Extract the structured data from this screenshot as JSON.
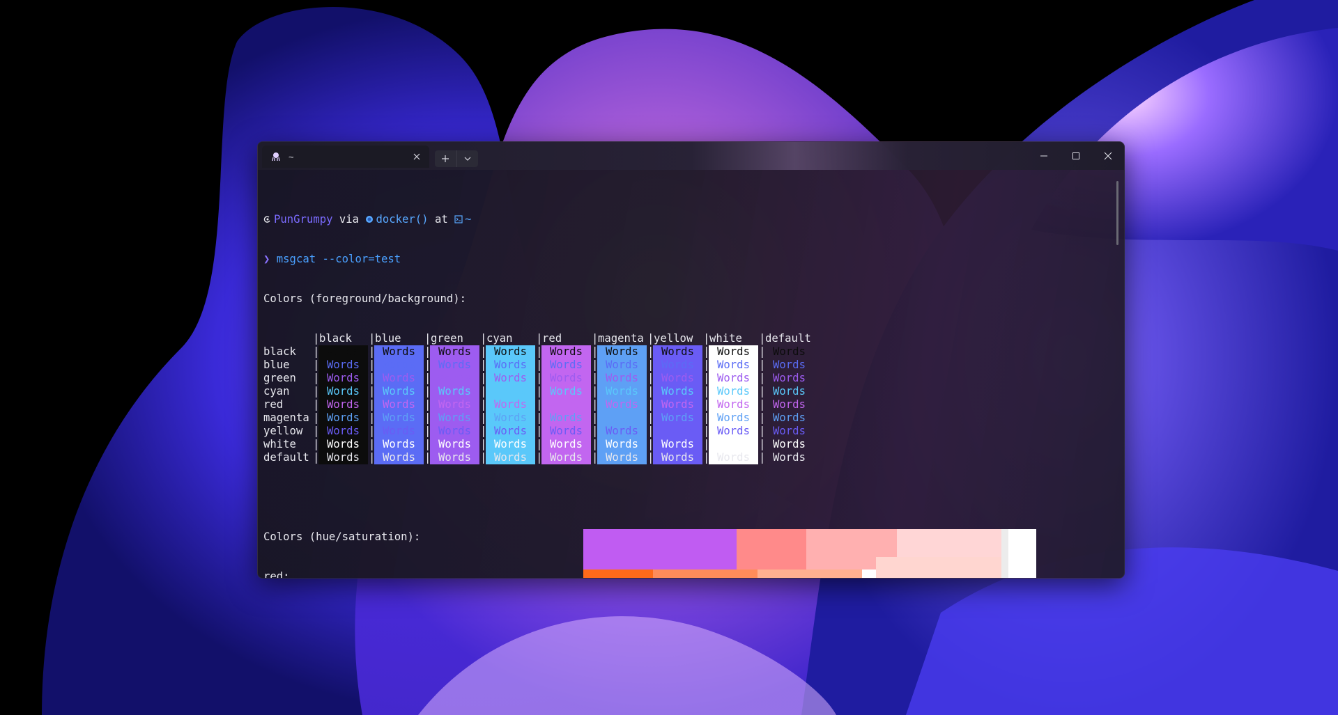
{
  "window": {
    "tab_title": "~",
    "tab_icon": "octopus-icon",
    "controls": [
      "minimize-icon",
      "maximize-icon",
      "close-icon"
    ]
  },
  "prompt": {
    "user": "PunGrumpy",
    "via": "via",
    "docker": "docker()",
    "at": "at",
    "path": "~",
    "arrow": "❯",
    "command": "msgcat --color=test"
  },
  "table": {
    "heading": "Colors (foreground/background):",
    "columns": [
      "black",
      "blue",
      "green",
      "cyan",
      "red",
      "magenta",
      "yellow",
      "white",
      "default"
    ],
    "rows": [
      "black",
      "blue",
      "green",
      "cyan",
      "red",
      "magenta",
      "yellow",
      "white",
      "default"
    ],
    "cell_text": "Words",
    "colors": {
      "black": "#0c0c0c",
      "blue": "#5b6cf5",
      "green": "#9d5cf0",
      "cyan": "#5ac8fa",
      "red": "#c266f0",
      "magenta": "#5ea0f5",
      "yellow": "#6a5cf5",
      "white": "#ffffff",
      "default_fg": "#e8e8ee"
    }
  },
  "hue_saturation": {
    "heading": "Colors (hue/saturation):",
    "label": "red:"
  }
}
